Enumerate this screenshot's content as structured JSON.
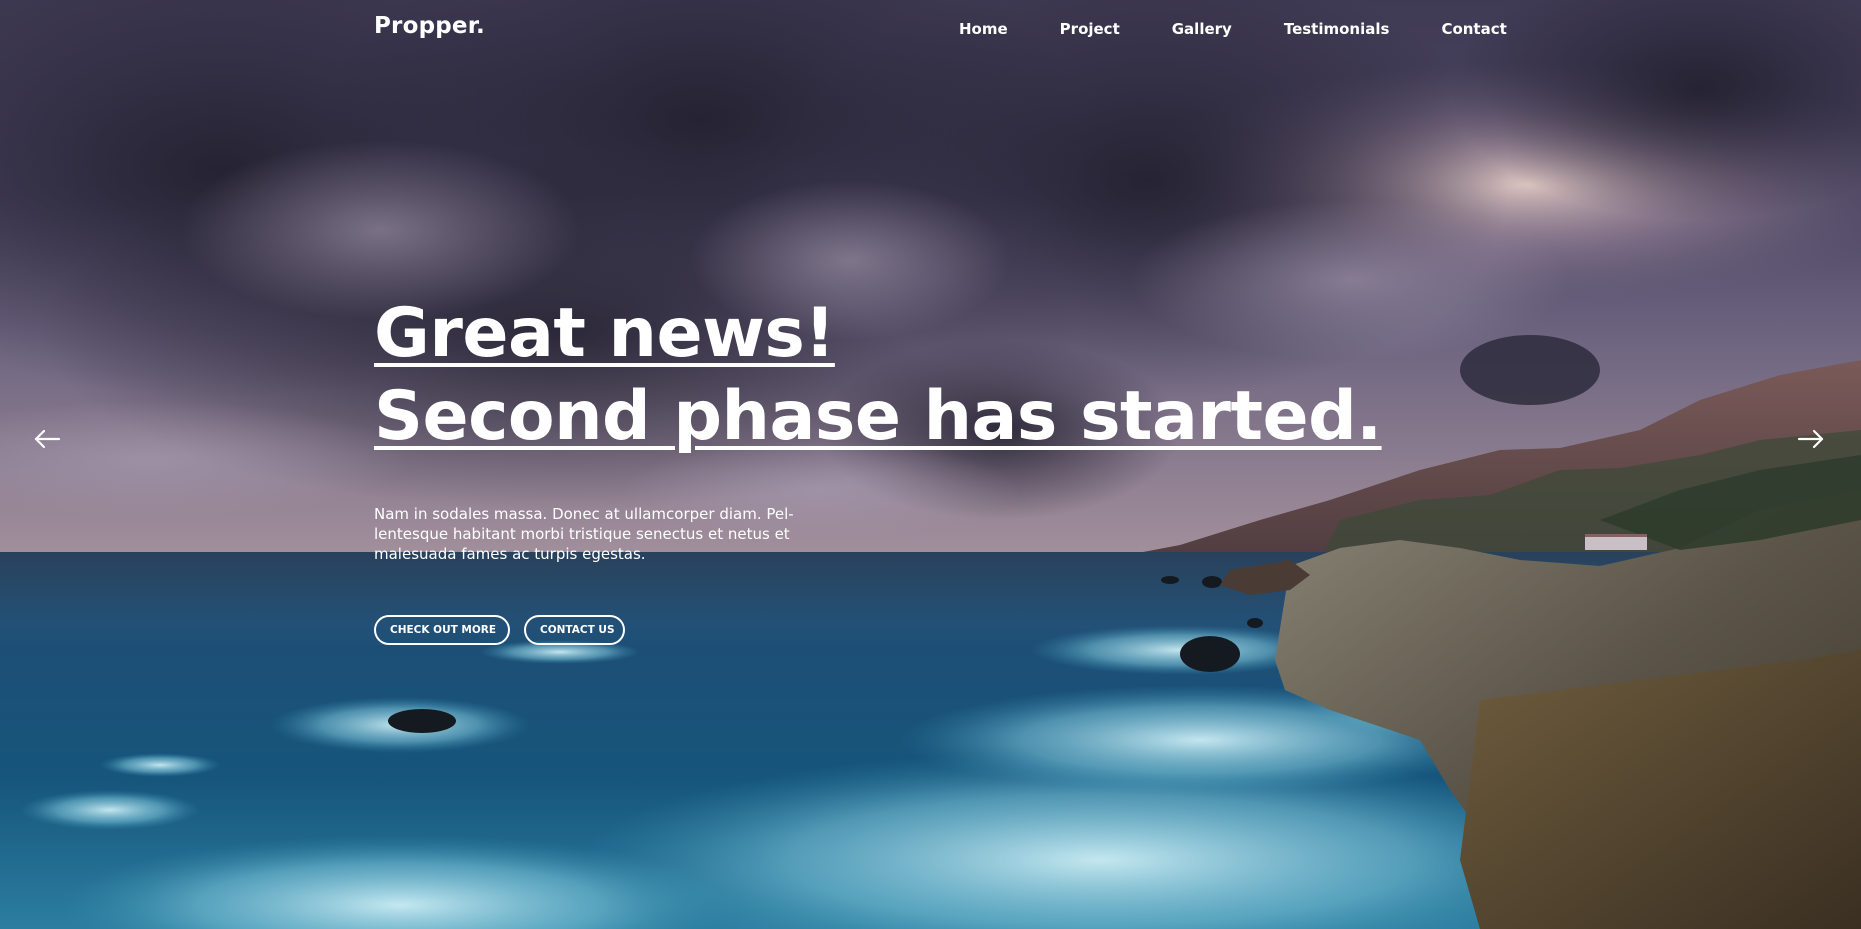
{
  "brand": {
    "logo": "Propper."
  },
  "nav": {
    "items": [
      {
        "label": "Home"
      },
      {
        "label": "Project"
      },
      {
        "label": "Gallery"
      },
      {
        "label": "Testimonials"
      },
      {
        "label": "Contact"
      }
    ]
  },
  "hero": {
    "headline_line1": "Great news!",
    "headline_line2": "Second phase has started.",
    "lead_line1": "Nam in sodales massa. Donec at ullamcorper diam. Pel-",
    "lead_line2": "lentesque habitant morbi tristique senectus et netus et",
    "lead_line3": "malesuada fames ac turpis egestas.",
    "cta_primary": "CHECK OUT MORE",
    "cta_secondary": "CONTACT US",
    "prev_icon": "arrow-left-icon",
    "next_icon": "arrow-right-icon"
  },
  "colors": {
    "text": "#ffffff",
    "sky_dark": "#2e2c40",
    "sky_light": "#8d7f98",
    "sea_deep": "#0f3a5c",
    "sea_foam": "#9fd6e6",
    "cliff": "#5a4a3c"
  }
}
